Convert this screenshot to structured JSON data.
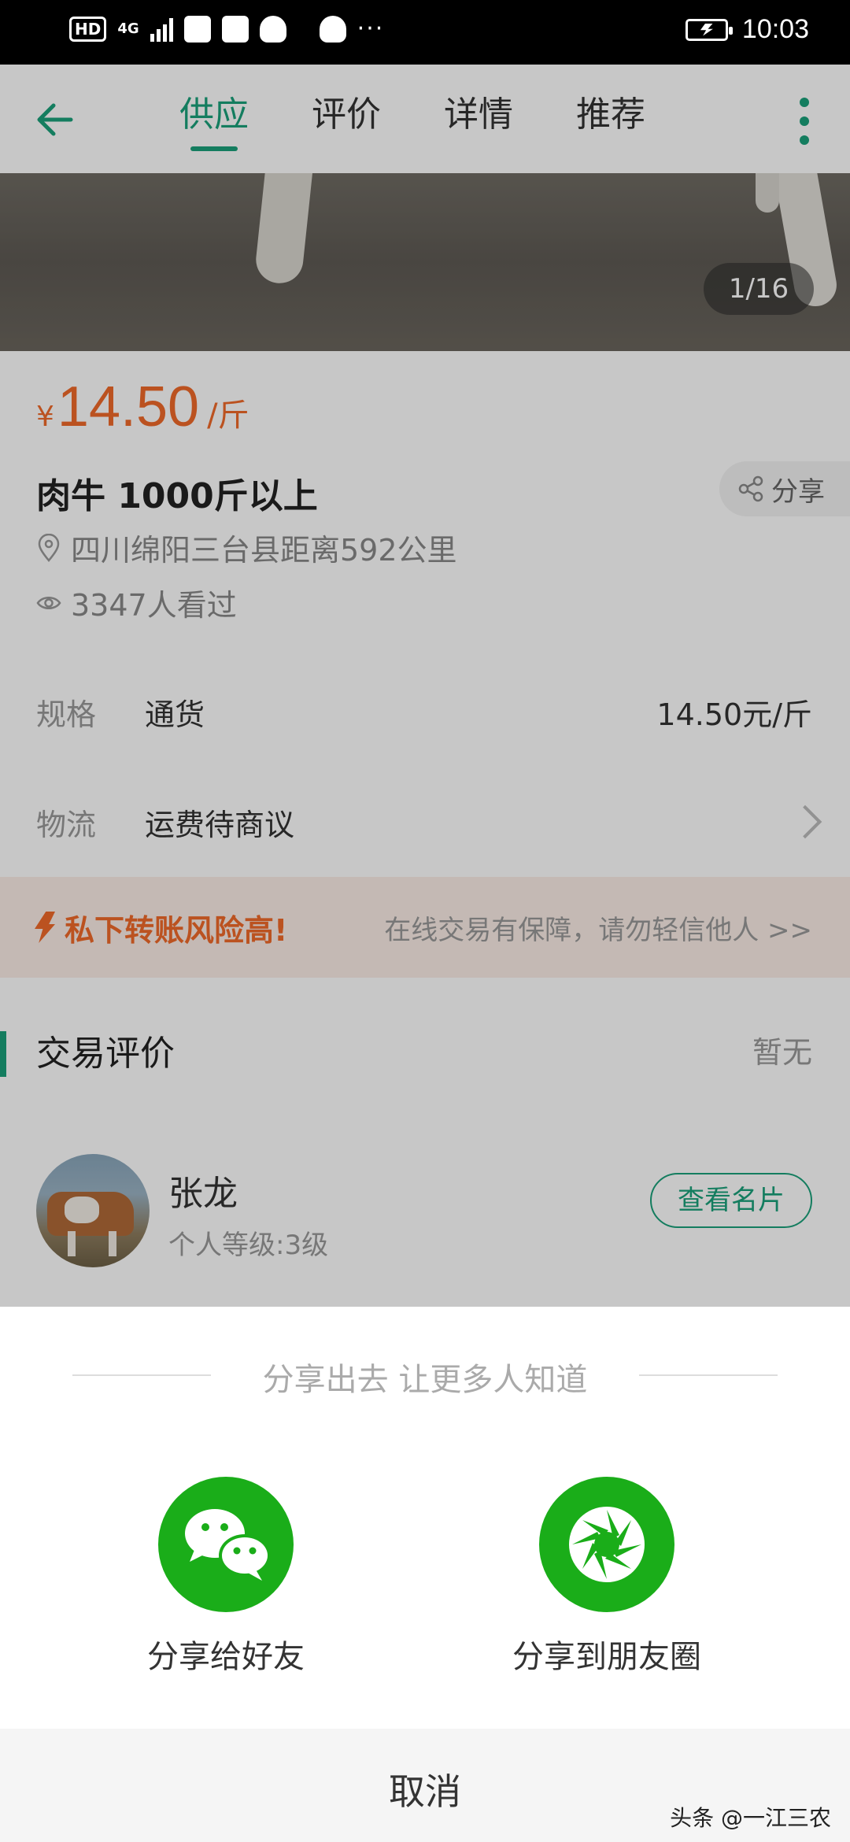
{
  "status_bar": {
    "hd": "HD",
    "network": "4G",
    "time": "10:03",
    "overflow": "···"
  },
  "nav": {
    "tabs": [
      {
        "label": "供应",
        "active": true
      },
      {
        "label": "评价",
        "active": false
      },
      {
        "label": "详情",
        "active": false
      },
      {
        "label": "推荐",
        "active": false
      }
    ],
    "accent_color": "#1aa07a"
  },
  "gallery": {
    "counter": "1/16"
  },
  "product": {
    "currency": "¥",
    "price": "14.50",
    "unit": "/斤",
    "title": "肉牛 1000斤以上",
    "share_label": "分享",
    "location": "四川绵阳三台县距离592公里",
    "views": "3347人看过",
    "price_color": "#f06a2a"
  },
  "spec": {
    "label": "规格",
    "value": "通货",
    "price": "14.50元/斤"
  },
  "logistics": {
    "label": "物流",
    "value": "运费待商议"
  },
  "warning": {
    "title": "私下转账风险高!",
    "subtitle": "在线交易有保障，请勿轻信他人 >>"
  },
  "reviews": {
    "heading": "交易评价",
    "status": "暂无"
  },
  "seller": {
    "name": "张龙",
    "level": "个人等级:3级",
    "card_button": "查看名片"
  },
  "share_sheet": {
    "title": "分享出去 让更多人知道",
    "options": [
      {
        "label": "分享给好友",
        "icon": "wechat-icon"
      },
      {
        "label": "分享到朋友圈",
        "icon": "moments-icon"
      }
    ],
    "cancel": "取消",
    "brand_color": "#1aad19"
  },
  "watermark": "头条 @一江三农"
}
